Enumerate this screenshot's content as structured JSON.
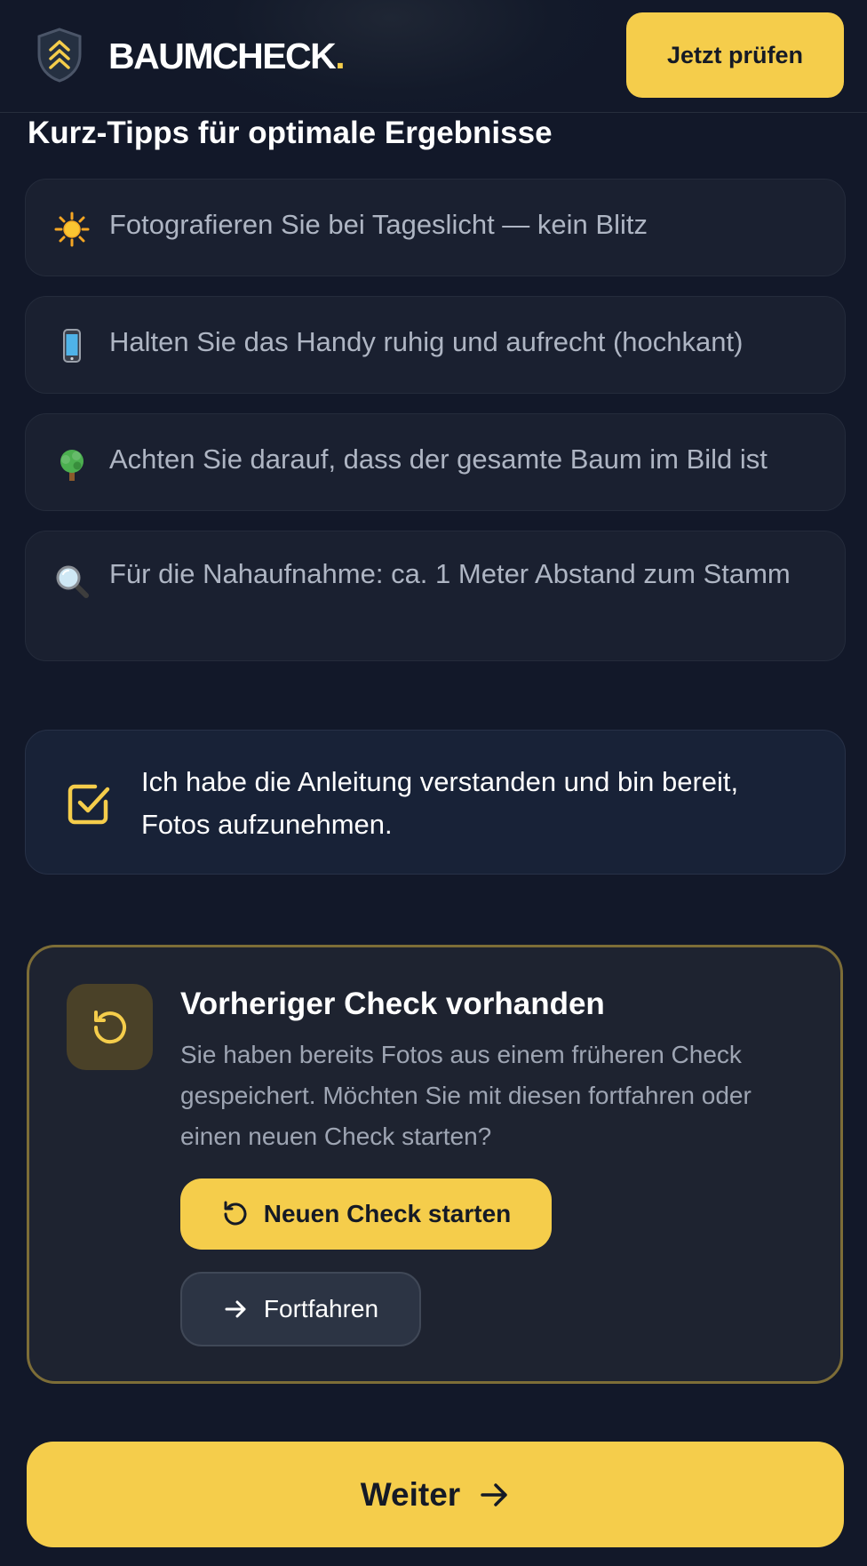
{
  "header": {
    "brand": "BAUMCHECK",
    "brand_dot": ".",
    "cta_label": "Jetzt prüfen"
  },
  "tips": {
    "title": "Kurz-Tipps für optimale Ergebnisse",
    "items": [
      {
        "icon": "sun-icon",
        "emoji": "☀️",
        "text": "Fotografieren Sie bei Tageslicht — kein Blitz"
      },
      {
        "icon": "phone-icon",
        "emoji": "📱",
        "text": "Halten Sie das Handy ruhig und aufrecht (hochkant)"
      },
      {
        "icon": "tree-icon",
        "emoji": "🌳",
        "text": "Achten Sie darauf, dass der gesamte Baum im Bild ist"
      },
      {
        "icon": "magnifier-icon",
        "emoji": "🔍",
        "text": "Für die Nahaufnahme: ca. 1 Meter Abstand zum Stamm"
      }
    ]
  },
  "confirm": {
    "checked": true,
    "text": "Ich habe die Anleitung verstanden und bin bereit, Fotos aufzunehmen."
  },
  "previous_check": {
    "title": "Vorheriger Check vorhanden",
    "description": "Sie haben bereits Fotos aus einem früheren Check gespeichert. Möchten Sie mit diesen fortfahren oder einen neuen Check starten?",
    "new_label": "Neuen Check starten",
    "continue_label": "Fortfahren"
  },
  "next_label": "Weiter",
  "colors": {
    "accent": "#f5cd4b",
    "background": "#121829",
    "card": "#1a2030",
    "card_border_accent": "#7d6d37"
  }
}
